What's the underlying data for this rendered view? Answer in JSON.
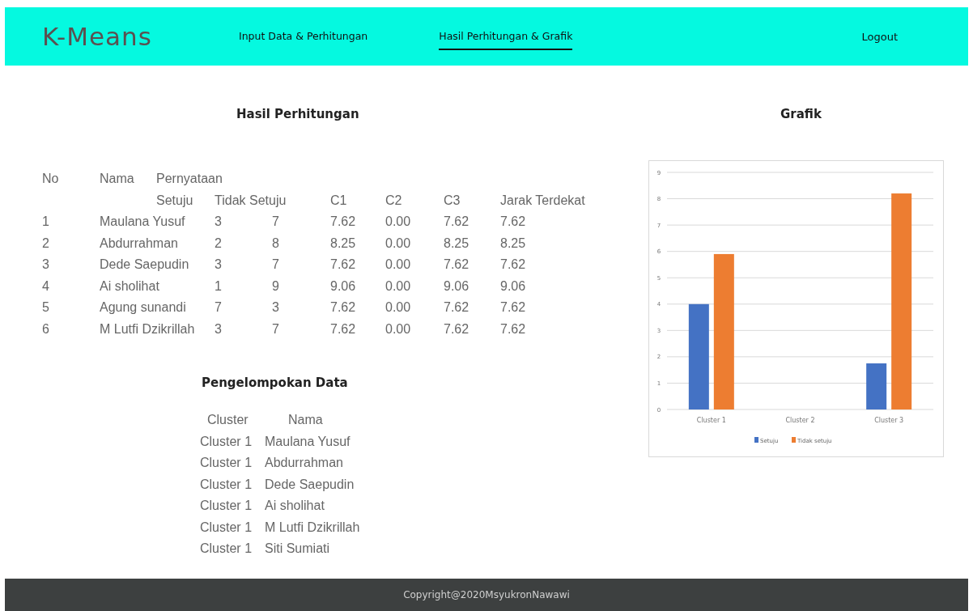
{
  "header": {
    "logo": "K-Means",
    "nav": [
      {
        "label": "Input Data & Perhitungan",
        "selected": false
      },
      {
        "label": "Hasil Perhitungan & Grafik",
        "selected": true
      }
    ],
    "logout": "Logout"
  },
  "results": {
    "title": "Hasil Perhitungan",
    "header_top": [
      "No",
      "Nama",
      "Pernyataan"
    ],
    "columns": [
      "",
      "Setuju",
      "Tidak Setuju",
      "",
      "C1",
      "C2",
      "C3",
      "Jarak Terdekat"
    ],
    "rows": [
      [
        "1",
        "Maulana Yusuf",
        "3",
        "7",
        "7.62",
        "0.00",
        "7.62",
        "7.62"
      ],
      [
        "2",
        "Abdurrahman",
        "2",
        "8",
        "8.25",
        "0.00",
        "8.25",
        "8.25"
      ],
      [
        "3",
        "Dede Saepudin",
        "3",
        "7",
        "7.62",
        "0.00",
        "7.62",
        "7.62"
      ],
      [
        "4",
        "Ai sholihat",
        "1",
        "9",
        "9.06",
        "0.00",
        "9.06",
        "9.06"
      ],
      [
        "5",
        "Agung sunandi",
        "7",
        "3",
        "7.62",
        "0.00",
        "7.62",
        "7.62"
      ],
      [
        "6",
        "M Lutfi Dzikrillah",
        "3",
        "7",
        "7.62",
        "0.00",
        "7.62",
        "7.62"
      ]
    ]
  },
  "grouping": {
    "title": "Pengelompokan Data",
    "columns": [
      "Cluster",
      "Nama"
    ],
    "rows": [
      [
        "Cluster 1",
        "Maulana Yusuf"
      ],
      [
        "Cluster 1",
        "Abdurrahman"
      ],
      [
        "Cluster 1",
        "Dede Saepudin"
      ],
      [
        "Cluster 1",
        "Ai sholihat"
      ],
      [
        "Cluster 1",
        "M Lutfi Dzikrillah"
      ],
      [
        "Cluster 1",
        "Siti Sumiati"
      ]
    ]
  },
  "chart": {
    "title": "Grafik",
    "chart_data": {
      "type": "bar",
      "grid": true,
      "legend": true,
      "categories": [
        "Cluster 1",
        "Cluster 2",
        "Cluster 3"
      ],
      "ylim": [
        0,
        9
      ],
      "yticks": [
        0,
        1,
        2,
        3,
        4,
        5,
        6,
        7,
        8,
        9
      ],
      "series": [
        {
          "name": "Setuju",
          "color": "#4472c4",
          "values": [
            4,
            0,
            1.75
          ]
        },
        {
          "name": "Tidak setuju",
          "color": "#ed7d31",
          "values": [
            5.9,
            0,
            8.2
          ]
        }
      ]
    }
  },
  "footer": "Copyright@2020MsyukronNawawi"
}
